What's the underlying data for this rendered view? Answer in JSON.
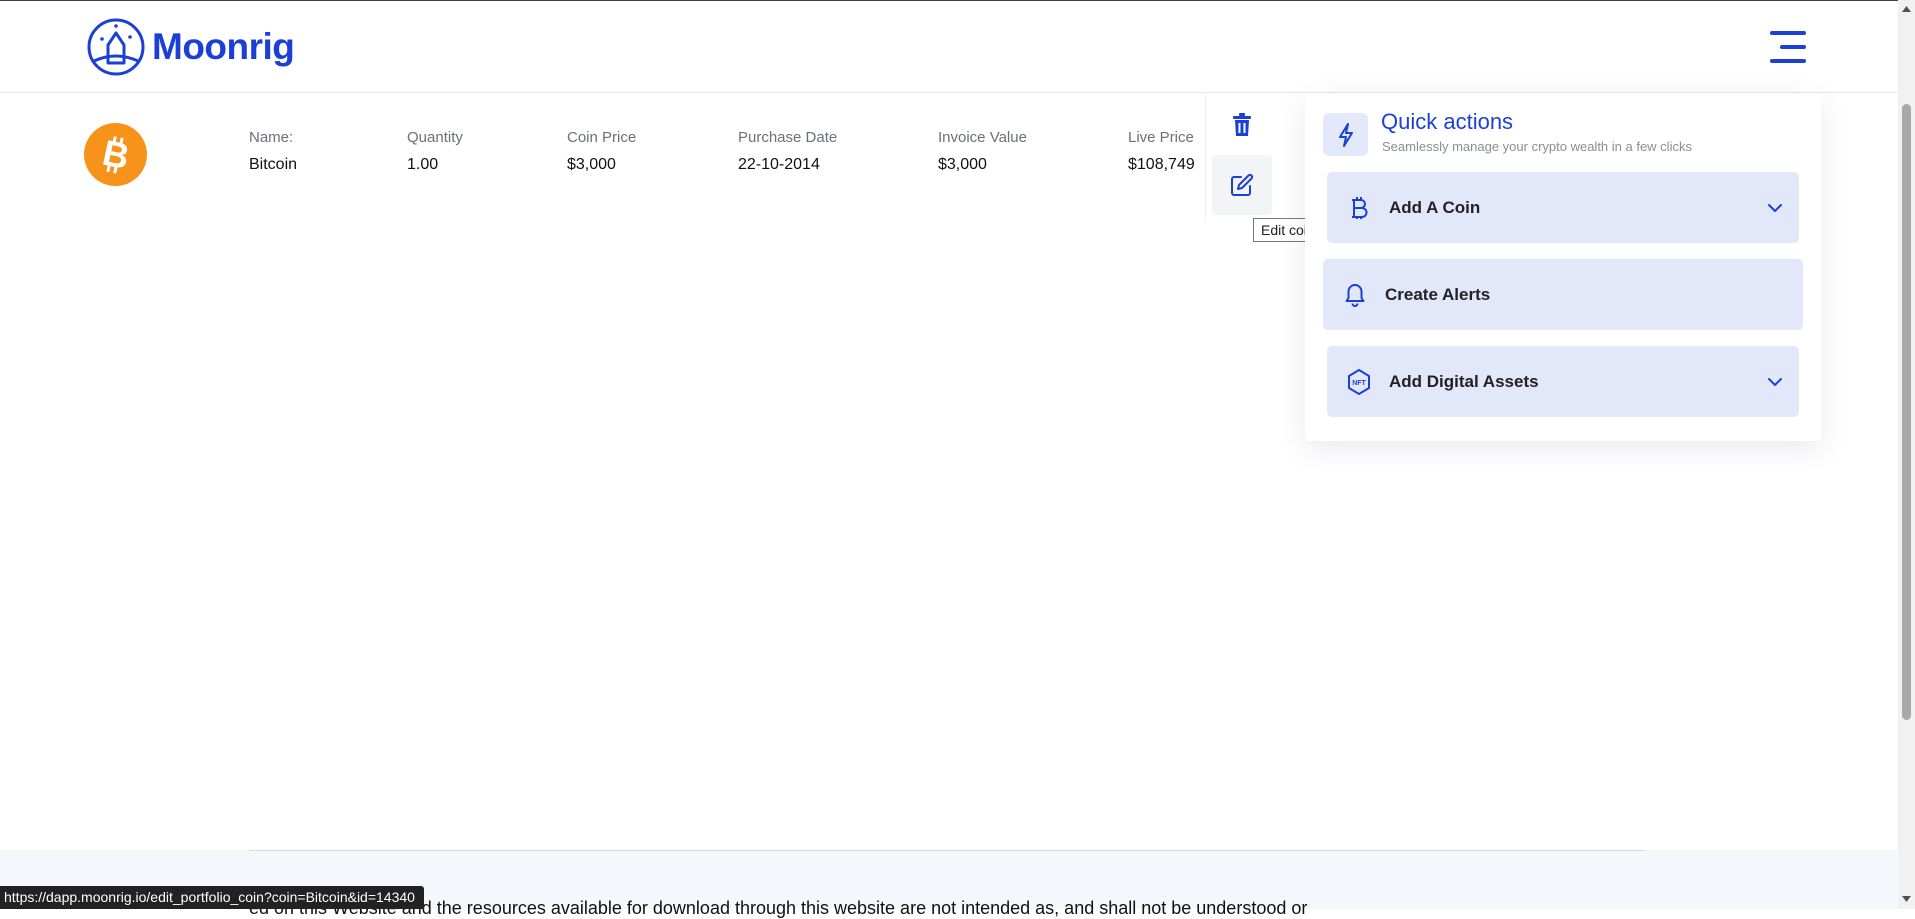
{
  "header": {
    "logo_text": "Moonrig",
    "menu_icon": "hamburger-menu-icon"
  },
  "coin": {
    "icon": "bitcoin-icon",
    "brand_color": "#f7931a",
    "columns": [
      {
        "label": "Name:",
        "value": "Bitcoin"
      },
      {
        "label": "Quantity",
        "value": "1.00"
      },
      {
        "label": "Coin Price",
        "value": "$3,000"
      },
      {
        "label": "Purchase Date",
        "value": "22-10-2014"
      },
      {
        "label": "Invoice Value",
        "value": "$3,000"
      },
      {
        "label": "Live Price",
        "value": "$108,749"
      }
    ],
    "actions": {
      "delete_icon": "trash-icon",
      "edit_icon": "edit-icon"
    },
    "tooltip": "Edit coin"
  },
  "quick_actions": {
    "icon": "lightning-icon",
    "title": "Quick actions",
    "subtitle": "Seamlessly manage your crypto wealth in a few clicks",
    "items": [
      {
        "label": "Add A Coin",
        "icon": "bitcoin-outline-icon",
        "expandable": true
      },
      {
        "label": "Create Alerts",
        "icon": "bell-icon",
        "expandable": false
      },
      {
        "label": "Add Digital Assets",
        "icon": "nft-icon",
        "expandable": true
      }
    ]
  },
  "footer": {
    "disclaimer_fragment": "ed on this Website and the resources available for download through this website are not intended as, and shall not be understood or"
  },
  "status_bar": {
    "url": "https://dapp.moonrig.io/edit_portfolio_coin?coin=Bitcoin&id=14340"
  },
  "colors": {
    "accent": "#1a40d8",
    "panel_item_bg": "#e3e7fa"
  }
}
